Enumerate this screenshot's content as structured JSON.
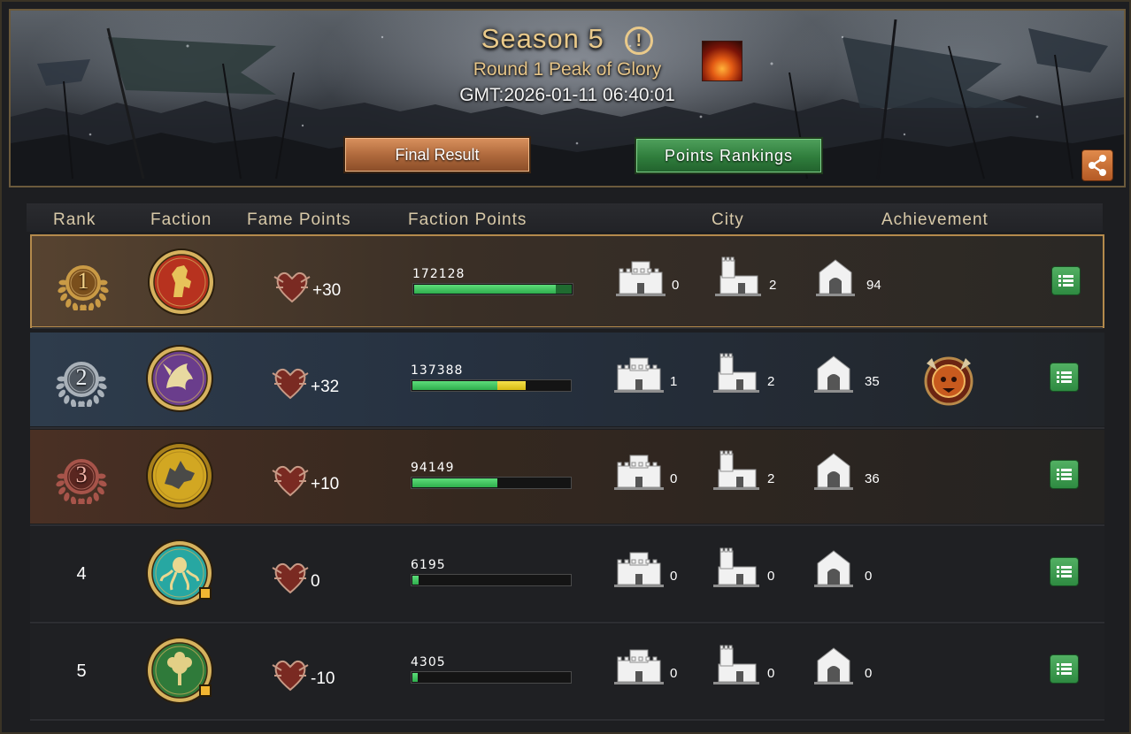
{
  "header": {
    "season_title": "Season 5",
    "info_symbol": "!",
    "round_label": "Round 1 Peak of Glory",
    "gmt": "GMT:2026-01-11 06:40:01",
    "final_result_label": "Final Result",
    "points_rankings_label": "Points Rankings",
    "share_icon": "share-icon"
  },
  "table": {
    "columns": {
      "rank": "Rank",
      "faction": "Faction",
      "fame_points": "Fame Points",
      "faction_points": "Faction Points",
      "city": "City",
      "achievement": "Achievement"
    },
    "rows": [
      {
        "rank": "1",
        "faction_icon": "lion-sigil-icon",
        "fame": "+30",
        "faction_points": "172128",
        "progress_fraction": 0.9,
        "city_a": "0",
        "city_b": "2",
        "city_c": "94",
        "achievement": null
      },
      {
        "rank": "2",
        "faction_icon": "dragon-sigil-icon",
        "fame": "+32",
        "faction_points": "137388",
        "progress_fraction": 0.72,
        "city_a": "1",
        "city_b": "2",
        "city_c": "35",
        "achievement": "horned-skull-badge-icon"
      },
      {
        "rank": "3",
        "faction_icon": "direwolf-sigil-icon",
        "fame": "+10",
        "faction_points": "94149",
        "progress_fraction": 0.54,
        "city_a": "0",
        "city_b": "2",
        "city_c": "36",
        "achievement": null
      },
      {
        "rank": "4",
        "faction_icon": "kraken-sigil-icon",
        "fame": "0",
        "faction_points": "6195",
        "progress_fraction": 0.04,
        "city_a": "0",
        "city_b": "0",
        "city_c": "0",
        "achievement": null
      },
      {
        "rank": "5",
        "faction_icon": "rose-sigil-icon",
        "fame": "-10",
        "faction_points": "4305",
        "progress_fraction": 0.03,
        "city_a": "0",
        "city_b": "0",
        "city_c": "0",
        "achievement": null
      }
    ]
  },
  "colors": {
    "gold_text": "#e9c98a",
    "rank1_border": "#b48a4c",
    "progress_green": "#3cc35b",
    "progress_yellow": "#e8d02a",
    "detail_button_green": "#3d9b4f"
  }
}
